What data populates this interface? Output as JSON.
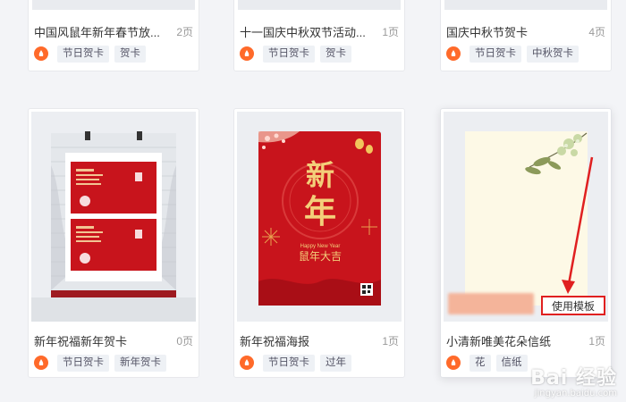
{
  "top_row": [
    {
      "title": "中国风鼠年新年春节放...",
      "pages": "2页",
      "tags": [
        "节日贺卡",
        "贺卡"
      ]
    },
    {
      "title": "十一国庆中秋双节活动...",
      "pages": "1页",
      "tags": [
        "节日贺卡",
        "贺卡"
      ]
    },
    {
      "title": "国庆中秋节贺卡",
      "pages": "4页",
      "tags": [
        "节日贺卡",
        "中秋贺卡"
      ]
    }
  ],
  "bottom_row": [
    {
      "title": "新年祝福新年贺卡",
      "pages": "0页",
      "tags": [
        "节日贺卡",
        "新年贺卡"
      ]
    },
    {
      "title": "新年祝福海报",
      "pages": "1页",
      "tags": [
        "节日贺卡",
        "过年"
      ]
    },
    {
      "title": "小清新唯美花朵信纸",
      "pages": "1页",
      "tags": [
        "花",
        "信纸"
      ],
      "use_label": "使用模板"
    }
  ],
  "poster": {
    "big_chars": [
      "新",
      "年"
    ],
    "english": "Happy New Year",
    "slogan": "鼠年大吉"
  },
  "watermark": {
    "main": "Bai 经验",
    "sub": "jingyan.baidu.com"
  },
  "colors": {
    "brand": "#ff6a2a",
    "poster_red": "#c8141c",
    "gold": "#f3cf7a",
    "highlight": "#e02020"
  }
}
